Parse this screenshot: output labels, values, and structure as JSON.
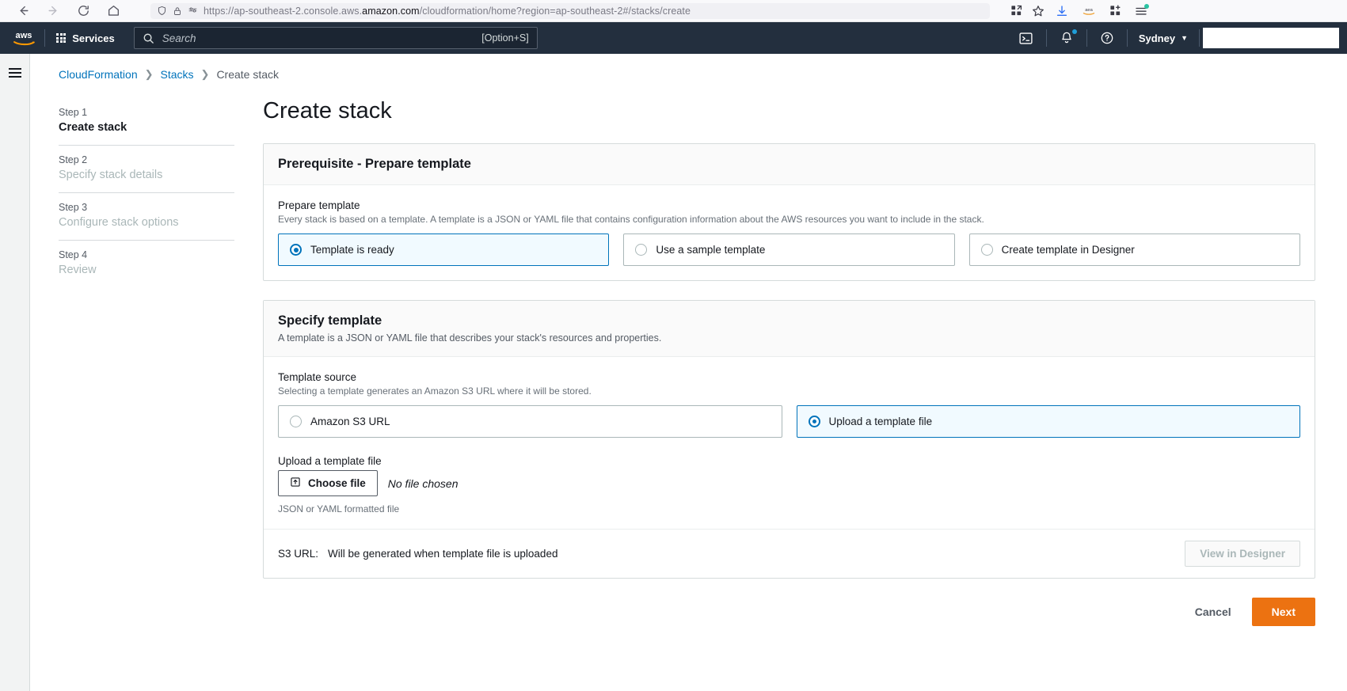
{
  "browser": {
    "back_icon": "back-arrow-icon",
    "forward_icon": "forward-arrow-icon",
    "reload_icon": "reload-icon",
    "home_icon": "home-icon",
    "url_protocol": "https://ap-southeast-2.console.aws.",
    "url_domain": "amazon.com",
    "url_path": "/cloudformation/home?region=ap-southeast-2#/stacks/create",
    "shield_icon": "shield-icon",
    "lock_icon": "lock-icon",
    "permissions_icon": "permissions-icon",
    "split_view_icon": "split-view-icon",
    "bookmark_icon": "bookmark-star-icon",
    "download_icon": "download-icon",
    "amazon_ext_icon": "amazon-extension-icon",
    "extensions_icon": "extensions-icon",
    "menu_icon": "app-menu-icon"
  },
  "aws_nav": {
    "logo": "aws-logo",
    "services_label": "Services",
    "search_placeholder": "Search",
    "search_shortcut": "[Option+S]",
    "cloudshell_icon": "cloudshell-icon",
    "notifications_icon": "notifications-bell-icon",
    "help_icon": "help-circle-icon",
    "region_label": "Sydney",
    "region_caret": "▼",
    "account_label": ""
  },
  "breadcrumb": {
    "items": [
      {
        "label": "CloudFormation",
        "link": true
      },
      {
        "label": "Stacks",
        "link": true
      },
      {
        "label": "Create stack",
        "link": false
      }
    ],
    "separator": "❯"
  },
  "steps": [
    {
      "num": "Step 1",
      "title": "Create stack",
      "active": true
    },
    {
      "num": "Step 2",
      "title": "Specify stack details",
      "active": false
    },
    {
      "num": "Step 3",
      "title": "Configure stack options",
      "active": false
    },
    {
      "num": "Step 4",
      "title": "Review",
      "active": false
    }
  ],
  "page": {
    "title": "Create stack"
  },
  "prerequisite_card": {
    "heading": "Prerequisite - Prepare template",
    "field_label": "Prepare template",
    "field_desc": "Every stack is based on a template. A template is a JSON or YAML file that contains configuration information about the AWS resources you want to include in the stack.",
    "options": [
      {
        "label": "Template is ready",
        "selected": true
      },
      {
        "label": "Use a sample template",
        "selected": false
      },
      {
        "label": "Create template in Designer",
        "selected": false
      }
    ]
  },
  "specify_card": {
    "heading": "Specify template",
    "heading_desc": "A template is a JSON or YAML file that describes your stack's resources and properties.",
    "source_label": "Template source",
    "source_desc": "Selecting a template generates an Amazon S3 URL where it will be stored.",
    "source_options": [
      {
        "label": "Amazon S3 URL",
        "selected": false
      },
      {
        "label": "Upload a template file",
        "selected": true
      }
    ],
    "upload_label": "Upload a template file",
    "choose_file_label": "Choose file",
    "choose_file_icon": "upload-file-icon",
    "no_file_text": "No file chosen",
    "format_hint": "JSON or YAML formatted file",
    "s3_url_label": "S3 URL:",
    "s3_url_value": "Will be generated when template file is uploaded",
    "view_designer_label": "View in Designer"
  },
  "footer": {
    "cancel_label": "Cancel",
    "next_label": "Next"
  },
  "colors": {
    "aws_navy": "#232f3e",
    "aws_orange": "#ec7211",
    "link_blue": "#0073bb",
    "selected_bg": "#f1faff"
  }
}
